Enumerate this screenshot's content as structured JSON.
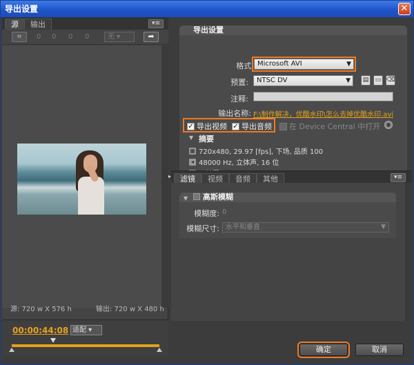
{
  "window": {
    "title": "导出设置",
    "close_glyph": "✕"
  },
  "left_panel": {
    "tabs": [
      {
        "label": "源"
      },
      {
        "label": "输出"
      }
    ],
    "menu_glyph": "▾≡",
    "crop_glyph": "⌗",
    "crop_values": [
      "0",
      "0",
      "0",
      "0"
    ],
    "aspect_select": "无",
    "rotate_glyph": "➦",
    "source_info": "源: 720 w X 576 h",
    "output_info": "输出: 720 w X 480 h",
    "timecode": "00:00:44:08",
    "fit_select": "适配"
  },
  "export_settings": {
    "section_title": "导出设置",
    "format_label": "格式:",
    "format_value": "Microsoft AVI",
    "preset_label": "预置:",
    "preset_value": "NTSC DV",
    "comment_label": "注释:",
    "comment_value": "",
    "output_name_label": "输出名称:",
    "output_name_value": "F:\\制作解决，优酷水印\\怎么去掉优酷水印.avi",
    "export_video_label": "导出视频",
    "export_audio_label": "导出音频",
    "device_central_label": "在 Device Central 中打开",
    "summary_title": "摘要",
    "summary_lines": [
      "720x480, 29.97 [fps], 下场, 品质 100",
      "48000 Hz, 立体声, 16 位",
      "无摘要可用"
    ]
  },
  "settings_tabs": [
    {
      "label": "滤镜"
    },
    {
      "label": "视频"
    },
    {
      "label": "音频"
    },
    {
      "label": "其他"
    }
  ],
  "gaussian_blur": {
    "title": "高斯模糊",
    "blurriness_label": "模糊度:",
    "blurriness_value": "0",
    "dimension_label": "模糊尺寸:",
    "dimension_value": "水平和垂直"
  },
  "buttons": {
    "ok": "确定",
    "cancel": "取消"
  },
  "colors": {
    "accent_orange": "#f07a22",
    "timecode_gold": "#e8a31c",
    "titlebar_blue": "#1f55c9"
  }
}
